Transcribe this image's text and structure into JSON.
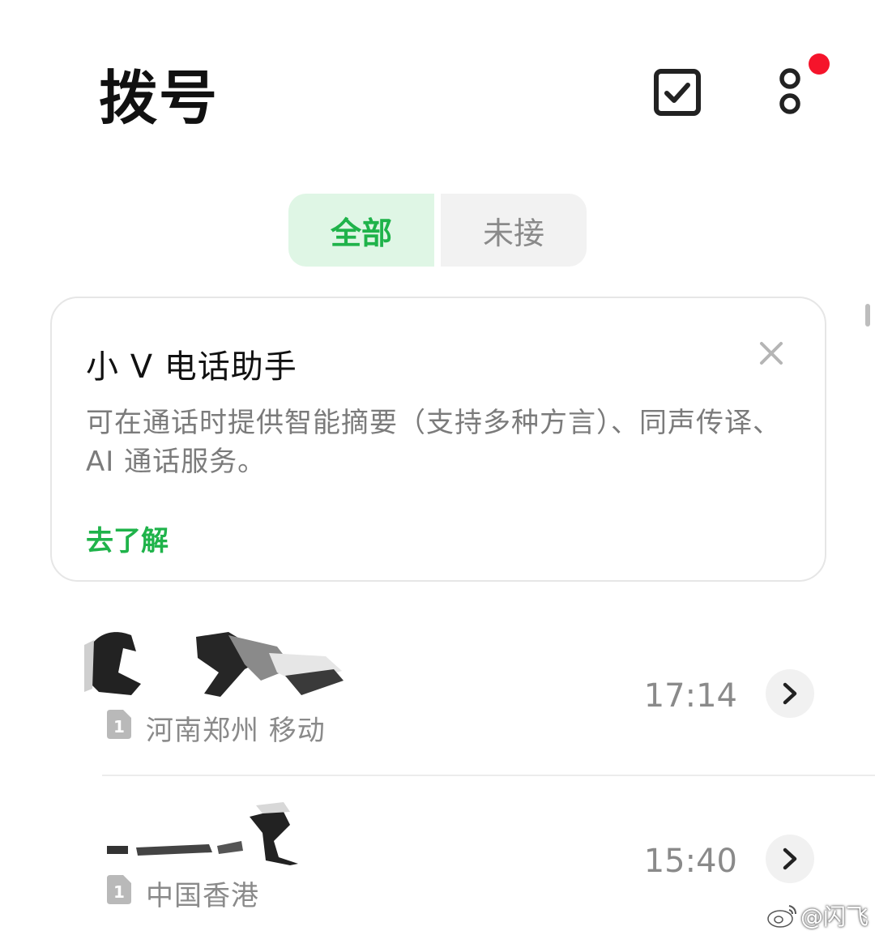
{
  "header": {
    "title": "拨号",
    "checkbox_icon": "checkbox-icon",
    "more_icon": "more-icon",
    "badge_color": "#f5142b"
  },
  "tabs": [
    {
      "label": "全部",
      "selected": true
    },
    {
      "label": "未接",
      "selected": false
    }
  ],
  "promo_card": {
    "title": "小 V 电话助手",
    "description": "可在通话时提供智能摘要（支持多种方言）、同声传译、AI 通话服务。",
    "link_label": "去了解",
    "close_icon": "close-icon"
  },
  "calls": [
    {
      "number": "",
      "sim": "1",
      "location": "河南郑州  移动",
      "time": "17:14"
    },
    {
      "number": "",
      "sim": "1",
      "location": "中国香港",
      "time": "15:40"
    }
  ],
  "watermark": "@闪飞",
  "colors": {
    "accent": "#1fb34a",
    "accent_bg": "#dff6e5"
  }
}
